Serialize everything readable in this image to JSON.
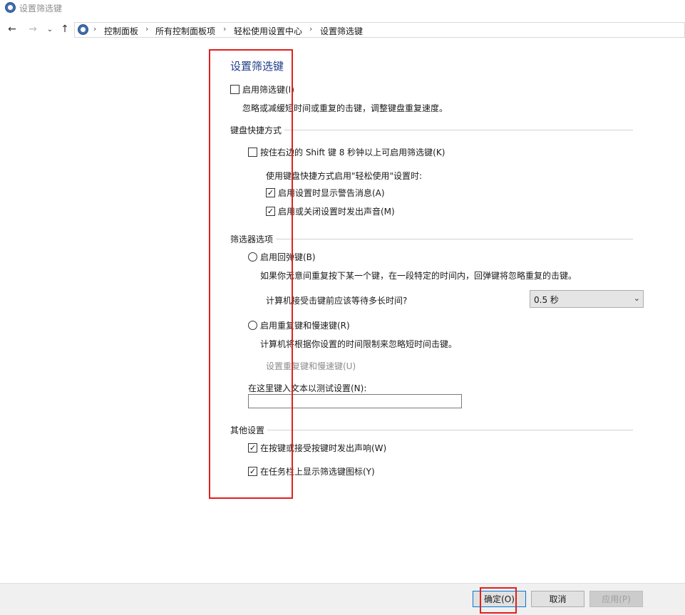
{
  "window": {
    "title": "设置筛选键"
  },
  "breadcrumb": {
    "items": [
      "控制面板",
      "所有控制面板项",
      "轻松使用设置中心",
      "设置筛选键"
    ]
  },
  "main": {
    "title": "设置筛选键",
    "enable_filter": {
      "label": "启用筛选键(I)",
      "checked": false,
      "description": "忽略或减缓短时间或重复的击键，调整键盘重复速度。"
    },
    "shortcut_section": {
      "heading": "键盘快捷方式",
      "shift_option": {
        "label": "按住右边的 Shift 键 8 秒钟以上可启用筛选键(K)",
        "checked": false
      },
      "sub_heading": "使用键盘快捷方式启用\"轻松使用\"设置时:",
      "warning_option": {
        "label": "启用设置时显示警告消息(A)",
        "checked": true
      },
      "sound_option": {
        "label": "启用或关闭设置时发出声音(M)",
        "checked": true
      }
    },
    "filter_section": {
      "heading": "筛选器选项",
      "bounce_option": {
        "label": "启用回弹键(B)",
        "description": "如果你无意间重复按下某一个键，在一段特定的时间内，回弹键将忽略重复的击键。"
      },
      "wait_question": "计算机接受击键前应该等待多长时间?",
      "wait_value": "0.5 秒",
      "repeat_option": {
        "label": "启用重复键和慢速键(R)",
        "description": "计算机将根据你设置的时间限制来忽略短时间击键。"
      },
      "repeat_link": "设置重复键和慢速键(U)",
      "test_label": "在这里键入文本以测试设置(N):",
      "test_value": ""
    },
    "other_section": {
      "heading": "其他设置",
      "beep_option": {
        "label": "在按键或接受按键时发出声响(W)",
        "checked": true
      },
      "tray_option": {
        "label": "在任务栏上显示筛选键图标(Y)",
        "checked": true
      }
    }
  },
  "footer": {
    "ok": "确定(O)",
    "cancel": "取消",
    "apply": "应用(P)"
  },
  "check_mark": "✓",
  "colors": {
    "title": "#1f3c88",
    "annotation": "#e0201c",
    "footer": "#f0f0f0"
  }
}
